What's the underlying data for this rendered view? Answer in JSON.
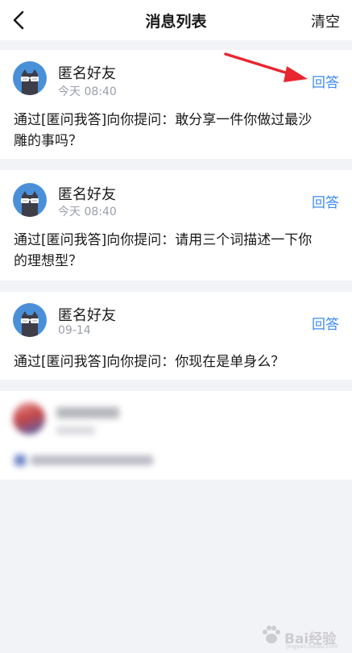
{
  "header": {
    "title": "消息列表",
    "clear_label": "清空"
  },
  "messages": [
    {
      "sender": "匿名好友",
      "time": "今天 08:40",
      "reply_label": "回答",
      "text_line1": "通过[匿问我答]向你提问：敢分享一件你做过最沙",
      "text_line2": "雕的事吗？"
    },
    {
      "sender": "匿名好友",
      "time": "今天 08:40",
      "reply_label": "回答",
      "text_line1": "通过[匿问我答]向你提问：请用三个词描述一下你",
      "text_line2": "的理想型？"
    },
    {
      "sender": "匿名好友",
      "time": "09-14",
      "reply_label": "回答",
      "text_line1": "通过[匿问我答]向你提问：你现在是单身么？",
      "text_line2": ""
    }
  ],
  "colors": {
    "accent": "#3d8bf2",
    "annotation_arrow": "#e8262f",
    "avatar_bg": "#4a90d9",
    "background": "#f2f3f7"
  },
  "icons": {
    "back": "chevron-left-icon",
    "avatar": "anonymous-cat-avatar-icon"
  },
  "watermark": {
    "text": "Bai经验",
    "subtext": "jingyan.baidu.com"
  }
}
